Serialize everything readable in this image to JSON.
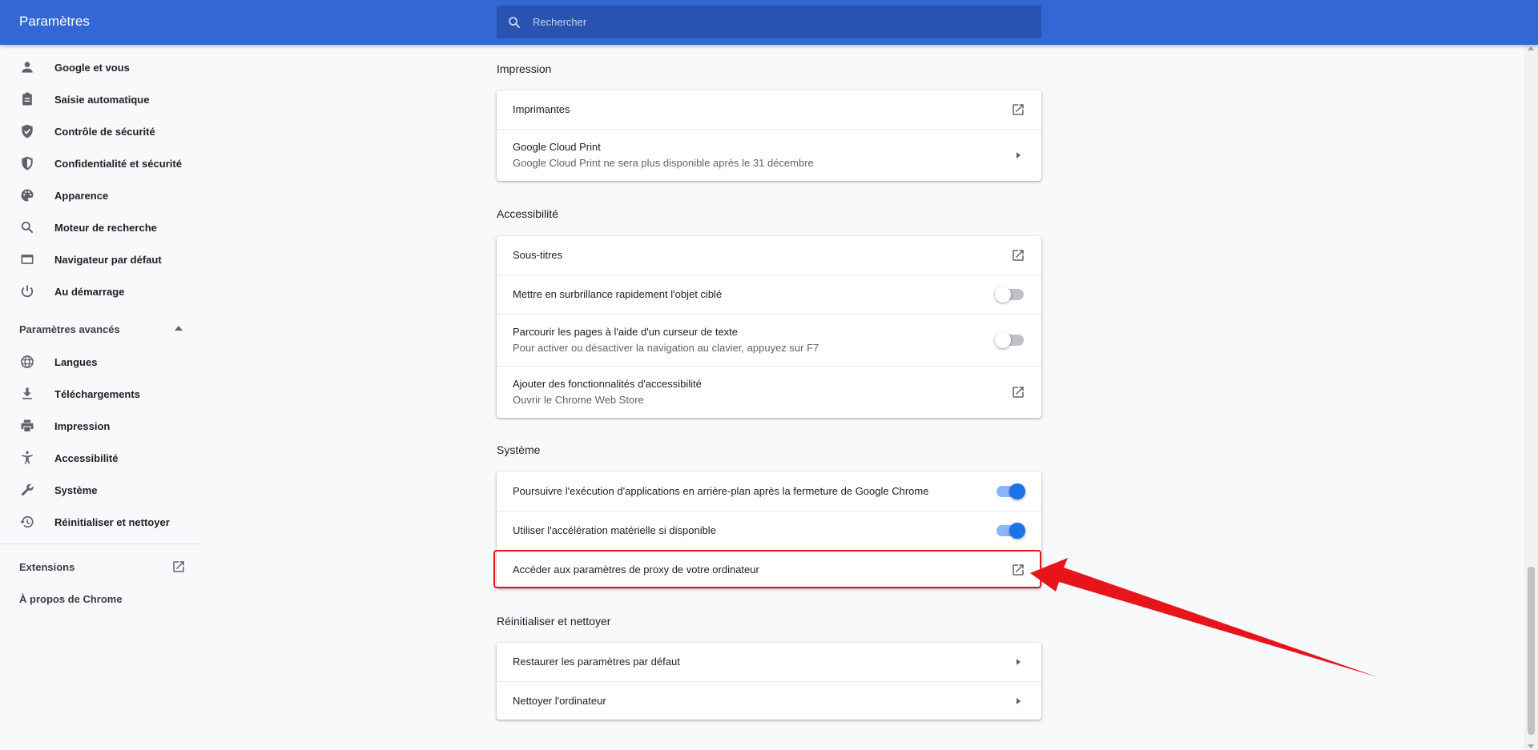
{
  "header": {
    "title": "Paramètres",
    "search_placeholder": "Rechercher"
  },
  "sidebar": {
    "items": [
      {
        "label": "Google et vous",
        "icon": "person-icon"
      },
      {
        "label": "Saisie automatique",
        "icon": "clipboard-icon"
      },
      {
        "label": "Contrôle de sécurité",
        "icon": "shield-check-icon"
      },
      {
        "label": "Confidentialité et sécurité",
        "icon": "shield-half-icon"
      },
      {
        "label": "Apparence",
        "icon": "palette-icon"
      },
      {
        "label": "Moteur de recherche",
        "icon": "search-icon"
      },
      {
        "label": "Navigateur par défaut",
        "icon": "browser-icon"
      },
      {
        "label": "Au démarrage",
        "icon": "power-icon"
      }
    ],
    "advanced_label": "Paramètres avancés",
    "advanced_items": [
      {
        "label": "Langues",
        "icon": "globe-icon"
      },
      {
        "label": "Téléchargements",
        "icon": "download-icon"
      },
      {
        "label": "Impression",
        "icon": "printer-icon"
      },
      {
        "label": "Accessibilité",
        "icon": "accessibility-icon"
      },
      {
        "label": "Système",
        "icon": "wrench-icon"
      },
      {
        "label": "Réinitialiser et nettoyer",
        "icon": "history-icon"
      }
    ],
    "extensions_label": "Extensions",
    "about_label": "À propos de Chrome"
  },
  "sections": {
    "impression": {
      "title": "Impression",
      "rows": [
        {
          "primary": "Imprimantes",
          "action": "external-link-icon"
        },
        {
          "primary": "Google Cloud Print",
          "secondary": "Google Cloud Print ne sera plus disponible après le 31 décembre",
          "action": "chevron-right-icon"
        }
      ]
    },
    "accessibilite": {
      "title": "Accessibilité",
      "rows": [
        {
          "primary": "Sous-titres",
          "action": "external-link-icon"
        },
        {
          "primary": "Mettre en surbrillance rapidement l'objet ciblé",
          "action": "toggle",
          "toggle_on": false
        },
        {
          "primary": "Parcourir les pages à l'aide d'un curseur de texte",
          "secondary": "Pour activer ou désactiver la navigation au clavier, appuyez sur F7",
          "action": "toggle",
          "toggle_on": false
        },
        {
          "primary": "Ajouter des fonctionnalités d'accessibilité",
          "secondary": "Ouvrir le Chrome Web Store",
          "action": "external-link-icon"
        }
      ]
    },
    "systeme": {
      "title": "Système",
      "rows": [
        {
          "primary": "Poursuivre l'exécution d'applications en arrière-plan après la fermeture de Google Chrome",
          "action": "toggle",
          "toggle_on": true
        },
        {
          "primary": "Utiliser l'accélération matérielle si disponible",
          "action": "toggle",
          "toggle_on": true
        },
        {
          "primary": "Accéder aux paramètres de proxy de votre ordinateur",
          "action": "external-link-icon"
        }
      ]
    },
    "reinitialiser": {
      "title": "Réinitialiser et nettoyer",
      "rows": [
        {
          "primary": "Restaurer les paramètres par défaut",
          "action": "chevron-right-icon"
        },
        {
          "primary": "Nettoyer l'ordinateur",
          "action": "chevron-right-icon"
        }
      ]
    }
  },
  "colors": {
    "header": "#3367d6",
    "search_bg": "#2853b0",
    "highlight": "#e8141b",
    "toggle_on": "#1a73e8"
  }
}
